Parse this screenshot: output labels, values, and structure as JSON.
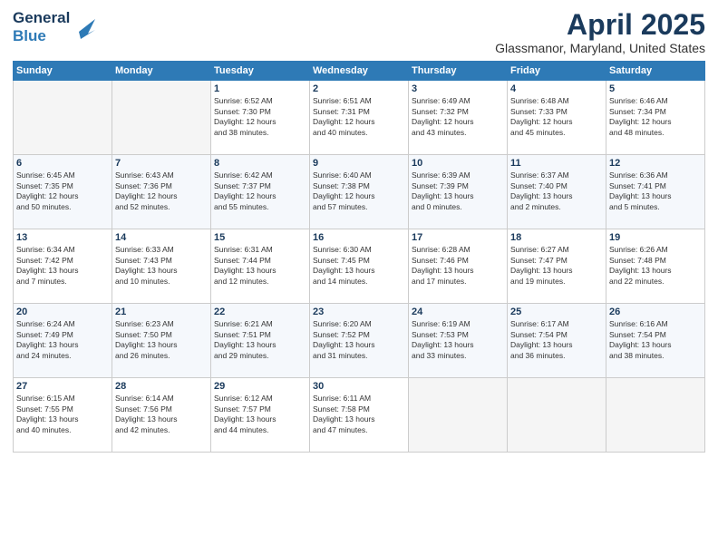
{
  "logo": {
    "general": "General",
    "blue": "Blue"
  },
  "header": {
    "month": "April 2025",
    "location": "Glassmanor, Maryland, United States"
  },
  "weekdays": [
    "Sunday",
    "Monday",
    "Tuesday",
    "Wednesday",
    "Thursday",
    "Friday",
    "Saturday"
  ],
  "weeks": [
    [
      {
        "day": "",
        "info": ""
      },
      {
        "day": "",
        "info": ""
      },
      {
        "day": "1",
        "info": "Sunrise: 6:52 AM\nSunset: 7:30 PM\nDaylight: 12 hours\nand 38 minutes."
      },
      {
        "day": "2",
        "info": "Sunrise: 6:51 AM\nSunset: 7:31 PM\nDaylight: 12 hours\nand 40 minutes."
      },
      {
        "day": "3",
        "info": "Sunrise: 6:49 AM\nSunset: 7:32 PM\nDaylight: 12 hours\nand 43 minutes."
      },
      {
        "day": "4",
        "info": "Sunrise: 6:48 AM\nSunset: 7:33 PM\nDaylight: 12 hours\nand 45 minutes."
      },
      {
        "day": "5",
        "info": "Sunrise: 6:46 AM\nSunset: 7:34 PM\nDaylight: 12 hours\nand 48 minutes."
      }
    ],
    [
      {
        "day": "6",
        "info": "Sunrise: 6:45 AM\nSunset: 7:35 PM\nDaylight: 12 hours\nand 50 minutes."
      },
      {
        "day": "7",
        "info": "Sunrise: 6:43 AM\nSunset: 7:36 PM\nDaylight: 12 hours\nand 52 minutes."
      },
      {
        "day": "8",
        "info": "Sunrise: 6:42 AM\nSunset: 7:37 PM\nDaylight: 12 hours\nand 55 minutes."
      },
      {
        "day": "9",
        "info": "Sunrise: 6:40 AM\nSunset: 7:38 PM\nDaylight: 12 hours\nand 57 minutes."
      },
      {
        "day": "10",
        "info": "Sunrise: 6:39 AM\nSunset: 7:39 PM\nDaylight: 13 hours\nand 0 minutes."
      },
      {
        "day": "11",
        "info": "Sunrise: 6:37 AM\nSunset: 7:40 PM\nDaylight: 13 hours\nand 2 minutes."
      },
      {
        "day": "12",
        "info": "Sunrise: 6:36 AM\nSunset: 7:41 PM\nDaylight: 13 hours\nand 5 minutes."
      }
    ],
    [
      {
        "day": "13",
        "info": "Sunrise: 6:34 AM\nSunset: 7:42 PM\nDaylight: 13 hours\nand 7 minutes."
      },
      {
        "day": "14",
        "info": "Sunrise: 6:33 AM\nSunset: 7:43 PM\nDaylight: 13 hours\nand 10 minutes."
      },
      {
        "day": "15",
        "info": "Sunrise: 6:31 AM\nSunset: 7:44 PM\nDaylight: 13 hours\nand 12 minutes."
      },
      {
        "day": "16",
        "info": "Sunrise: 6:30 AM\nSunset: 7:45 PM\nDaylight: 13 hours\nand 14 minutes."
      },
      {
        "day": "17",
        "info": "Sunrise: 6:28 AM\nSunset: 7:46 PM\nDaylight: 13 hours\nand 17 minutes."
      },
      {
        "day": "18",
        "info": "Sunrise: 6:27 AM\nSunset: 7:47 PM\nDaylight: 13 hours\nand 19 minutes."
      },
      {
        "day": "19",
        "info": "Sunrise: 6:26 AM\nSunset: 7:48 PM\nDaylight: 13 hours\nand 22 minutes."
      }
    ],
    [
      {
        "day": "20",
        "info": "Sunrise: 6:24 AM\nSunset: 7:49 PM\nDaylight: 13 hours\nand 24 minutes."
      },
      {
        "day": "21",
        "info": "Sunrise: 6:23 AM\nSunset: 7:50 PM\nDaylight: 13 hours\nand 26 minutes."
      },
      {
        "day": "22",
        "info": "Sunrise: 6:21 AM\nSunset: 7:51 PM\nDaylight: 13 hours\nand 29 minutes."
      },
      {
        "day": "23",
        "info": "Sunrise: 6:20 AM\nSunset: 7:52 PM\nDaylight: 13 hours\nand 31 minutes."
      },
      {
        "day": "24",
        "info": "Sunrise: 6:19 AM\nSunset: 7:53 PM\nDaylight: 13 hours\nand 33 minutes."
      },
      {
        "day": "25",
        "info": "Sunrise: 6:17 AM\nSunset: 7:54 PM\nDaylight: 13 hours\nand 36 minutes."
      },
      {
        "day": "26",
        "info": "Sunrise: 6:16 AM\nSunset: 7:54 PM\nDaylight: 13 hours\nand 38 minutes."
      }
    ],
    [
      {
        "day": "27",
        "info": "Sunrise: 6:15 AM\nSunset: 7:55 PM\nDaylight: 13 hours\nand 40 minutes."
      },
      {
        "day": "28",
        "info": "Sunrise: 6:14 AM\nSunset: 7:56 PM\nDaylight: 13 hours\nand 42 minutes."
      },
      {
        "day": "29",
        "info": "Sunrise: 6:12 AM\nSunset: 7:57 PM\nDaylight: 13 hours\nand 44 minutes."
      },
      {
        "day": "30",
        "info": "Sunrise: 6:11 AM\nSunset: 7:58 PM\nDaylight: 13 hours\nand 47 minutes."
      },
      {
        "day": "",
        "info": ""
      },
      {
        "day": "",
        "info": ""
      },
      {
        "day": "",
        "info": ""
      }
    ]
  ]
}
